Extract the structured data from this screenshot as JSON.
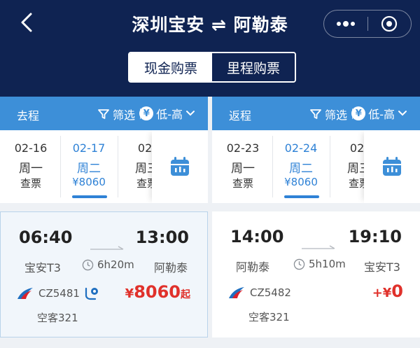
{
  "nav": {
    "back_icon": "chevron-left-icon",
    "title": "深圳宝安 ⇌ 阿勒泰",
    "more_icon": "more-dots-icon",
    "close_icon": "target-close-icon"
  },
  "purchase_tabs": [
    {
      "label": "现金购票",
      "active": true
    },
    {
      "label": "里程购票",
      "active": false
    }
  ],
  "colors": {
    "navy": "#0f2352",
    "header_blue": "#3d8fd8",
    "selected_blue": "#2f82d6",
    "price_red": "#e0312b",
    "airline_red": "#d9232e",
    "airline_blue": "#1f6fc0"
  },
  "outbound": {
    "direction": "去程",
    "filter_label": "筛选",
    "sort_label": "低-高",
    "yen_symbol": "¥",
    "dates": [
      {
        "date": "02-16",
        "weekday": "周一",
        "price": "查票",
        "selected": false
      },
      {
        "date": "02-17",
        "weekday": "周二",
        "price": "¥8060",
        "selected": true
      },
      {
        "date": "02-",
        "weekday": "周三",
        "price": "查票",
        "selected": false
      }
    ],
    "flight": {
      "dep_time": "06:40",
      "arr_time": "13:00",
      "dep_airport": "宝安T3",
      "arr_airport": "阿勒泰",
      "duration": "6h20m",
      "flight_no": "CZ5481",
      "aircraft": "空客321",
      "price_unit": "¥",
      "price": "8060",
      "price_suffix": "起"
    }
  },
  "return": {
    "direction": "返程",
    "filter_label": "筛选",
    "sort_label": "低-高",
    "yen_symbol": "¥",
    "dates": [
      {
        "date": "02-23",
        "weekday": "周一",
        "price": "查票",
        "selected": false
      },
      {
        "date": "02-24",
        "weekday": "周二",
        "price": "¥8060",
        "selected": true
      },
      {
        "date": "02-",
        "weekday": "周三",
        "price": "查票",
        "selected": false
      }
    ],
    "flight": {
      "dep_time": "14:00",
      "arr_time": "19:10",
      "dep_airport": "阿勒泰",
      "arr_airport": "宝安T3",
      "duration": "5h10m",
      "flight_no": "CZ5482",
      "aircraft": "空客321",
      "price_unit": "+¥",
      "price": "0",
      "price_suffix": ""
    }
  }
}
